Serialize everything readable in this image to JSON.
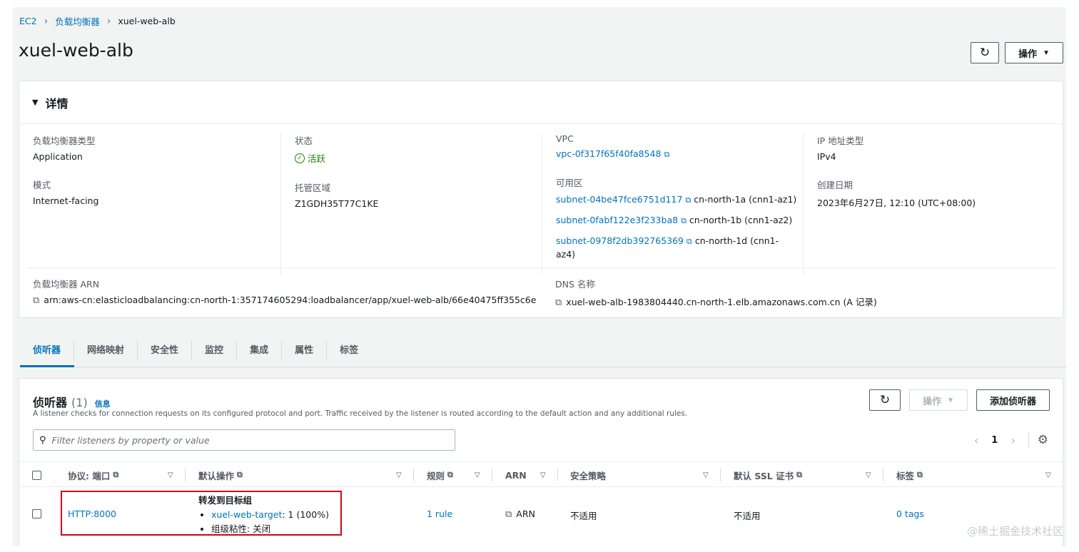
{
  "breadcrumb": {
    "items": [
      "EC2",
      "负载均衡器"
    ],
    "current": "xuel-web-alb"
  },
  "page": {
    "title": "xuel-web-alb",
    "actions_label": "操作"
  },
  "details": {
    "title": "详情",
    "lb_type_label": "负载均衡器类型",
    "lb_type_value": "Application",
    "scheme_label": "模式",
    "scheme_value": "Internet-facing",
    "state_label": "状态",
    "state_value": "活跃",
    "hosted_zone_label": "托管区域",
    "hosted_zone_value": "Z1GDH35T77C1KE",
    "vpc_label": "VPC",
    "vpc_value": "vpc-0f317f65f40fa8548",
    "az_label": "可用区",
    "subnets": [
      {
        "id": "subnet-04be47fce6751d117",
        "az": "cn-north-1a (cnn1-az1)"
      },
      {
        "id": "subnet-0fabf122e3f233ba8",
        "az": "cn-north-1b (cnn1-az2)"
      },
      {
        "id": "subnet-0978f2db392765369",
        "az": "cn-north-1d (cnn1-az4)"
      }
    ],
    "ip_type_label": "IP 地址类型",
    "ip_type_value": "IPv4",
    "created_label": "创建日期",
    "created_value": "2023年6月27日, 12:10 (UTC+08:00)",
    "arn_label": "负载均衡器 ARN",
    "arn_value": "arn:aws-cn:elasticloadbalancing:cn-north-1:357174605294:loadbalancer/app/xuel-web-alb/66e40475ff355c6e",
    "dns_label": "DNS 名称",
    "dns_value": "xuel-web-alb-1983804440.cn-north-1.elb.amazonaws.com.cn (A 记录)"
  },
  "tabs": [
    "侦听器",
    "网络映射",
    "安全性",
    "监控",
    "集成",
    "属性",
    "标签"
  ],
  "listeners": {
    "title": "侦听器",
    "count": "(1)",
    "info_label": "信息",
    "description": "A listener checks for connection requests on its configured protocol and port. Traffic received by the listener is routed according to the default action and any additional rules.",
    "actions_label": "操作",
    "add_label": "添加侦听器",
    "search_placeholder": "Filter listeners by property or value",
    "page_number": "1",
    "columns": [
      "协议: 端口",
      "默认操作",
      "规则",
      "ARN",
      "安全策略",
      "默认 SSL 证书",
      "标签"
    ],
    "row": {
      "protocol_port": "HTTP:8000",
      "action_title": "转发到目标组",
      "target_group": "xuel-web-target",
      "target_weight": ": 1 (100%)",
      "stickiness": "组级粘性: 关闭",
      "rules": "1 rule",
      "arn": "ARN",
      "security_policy": "不适用",
      "ssl_cert": "不适用",
      "tags": "0 tags"
    }
  },
  "watermark": "@稀土掘金技术社区",
  "colors": {
    "link": "#0073bb",
    "success": "#1d8102",
    "highlight": "#d0021b"
  }
}
